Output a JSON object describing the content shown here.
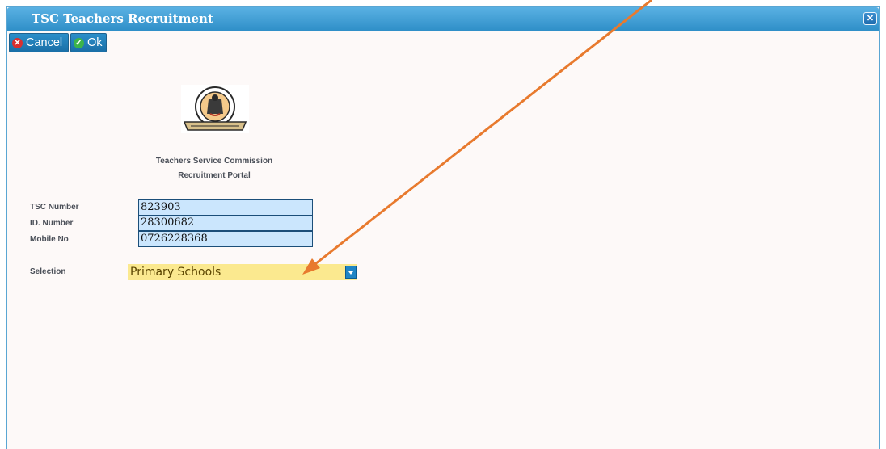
{
  "window": {
    "title": "TSC Teachers Recruitment",
    "close_icon": "close-icon"
  },
  "toolbar": {
    "cancel_label": "Cancel",
    "ok_label": "Ok"
  },
  "logo": {
    "alt": "Teachers Service Commission Kenya seal"
  },
  "heading": {
    "line1": "Teachers Service Commission",
    "line2": "Recruitment Portal"
  },
  "form": {
    "tsc_number": {
      "label": "TSC Number",
      "value": "823903"
    },
    "id_number": {
      "label": "ID. Number",
      "value": "28300682"
    },
    "mobile_no": {
      "label": "Mobile No",
      "value": "0726228368"
    },
    "selection": {
      "label": "Selection",
      "value": "Primary Schools"
    }
  },
  "colors": {
    "accent": "#2f8fc8",
    "field_bg": "#cbe6fd",
    "select_bg": "#fbe98f",
    "annotation_arrow": "#e87a2e"
  }
}
